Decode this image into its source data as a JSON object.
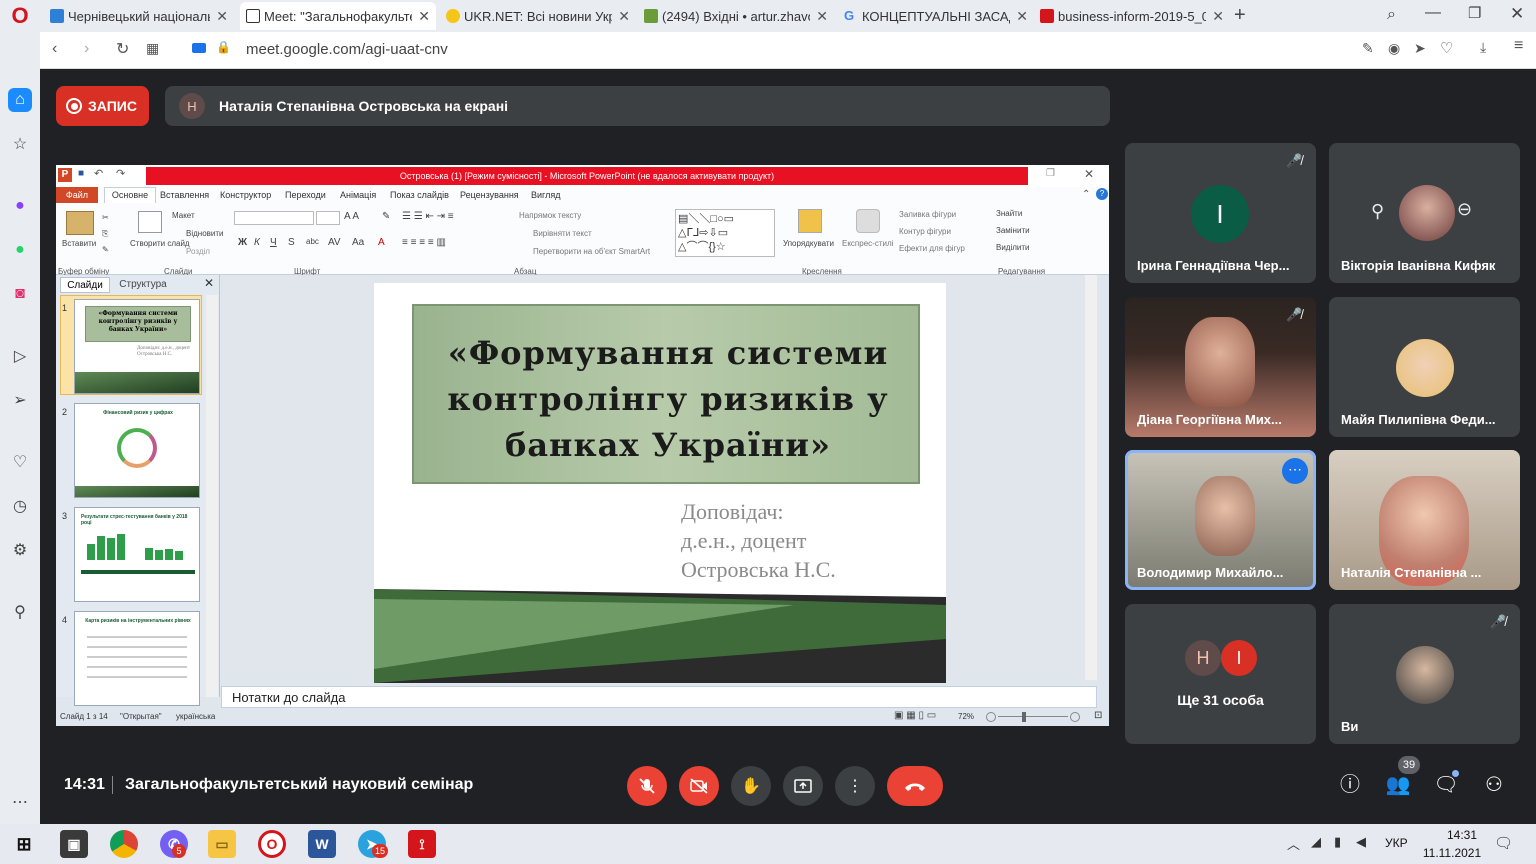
{
  "browser": {
    "tabs": [
      {
        "label": "Чернівецький національн",
        "icon_color": "#2e7fd8"
      },
      {
        "label": "Meet: \"Загальнофакультет",
        "icon_color": "#00897b"
      },
      {
        "label": "UKR.NET: Всі новини Укра",
        "icon_color": "#f5c518"
      },
      {
        "label": "(2494) Вхідні • artur.zhavor",
        "icon_color": "#6a9c3a"
      },
      {
        "label": "КОНЦЕПТУАЛЬНІ ЗАСАДИ",
        "icon_color": "#4285f4"
      },
      {
        "label": "business-inform-2019-5_0-",
        "icon_color": "#d4151c"
      }
    ],
    "url": "meet.google.com/agi-uaat-cnv",
    "logo": "O"
  },
  "meet": {
    "record_label": "ЗАПИС",
    "presenter_initial": "Н",
    "presenter_text": "Наталія Степанівна Островська на екрані",
    "time": "14:31",
    "meeting_name": "Загальнофакультетський науковий семінар",
    "participants_count": "39",
    "participants": [
      {
        "name": "Ірина Геннадіївна Чер...",
        "initial": "І",
        "avatar_color": "#0b5c44",
        "muted": true
      },
      {
        "name": "Вікторія Іванівна Кифяк",
        "muted": false
      },
      {
        "name": "Діана Георгіївна Мих...",
        "muted": true
      },
      {
        "name": "Майя Пилипівна Феди...",
        "muted": false
      },
      {
        "name": "Володимир Михайло...",
        "muted": false
      },
      {
        "name": "Наталія Степанівна ...",
        "muted": false
      },
      {
        "name": "Ще 31 особа",
        "initials": [
          "Н",
          "І"
        ]
      },
      {
        "name": "Ви",
        "muted": true
      }
    ]
  },
  "powerpoint": {
    "window_title": "Островська (1) [Режим сумісності] - Microsoft PowerPoint (не вдалося активувати продукт)",
    "tabs": [
      "Файл",
      "Основне",
      "Вставлення",
      "Конструктор",
      "Переходи",
      "Анімація",
      "Показ слайдів",
      "Рецензування",
      "Вигляд"
    ],
    "groups": [
      "Буфер обміну",
      "Слайди",
      "Шрифт",
      "Абзац",
      "Креслення",
      "Редагування"
    ],
    "ribbon_items": {
      "paste": "Вставити",
      "create_slide": "Створити слайд",
      "layout": "Макет",
      "reset": "Відновити",
      "section": "Розділ",
      "text_direction": "Напрямок тексту",
      "align_text": "Вирівняти текст",
      "smartart": "Перетворити на об'єкт SmartArt",
      "arrange": "Упорядкувати",
      "quick_styles": "Експрес-стилі",
      "shape_fill": "Заливка фігури",
      "shape_outline": "Контур фігури",
      "shape_effects": "Ефекти для фігур",
      "find": "Знайти",
      "replace": "Замінити",
      "select": "Виділити"
    },
    "pane_tabs": [
      "Слайди",
      "Структура"
    ],
    "thumbnails": [
      {
        "num": "1",
        "title": "«Формування системи контролінгу ризиків у банках України»",
        "sub": "Доповідач: д.е.н., доцент Островська Н.С."
      },
      {
        "num": "2",
        "title": "Фінансовий ризик у цифрах"
      },
      {
        "num": "3",
        "title": "Результати стрес-тестування банків у 2018 році"
      },
      {
        "num": "4",
        "title": "Карта ризиків на інструментальних рівнях"
      }
    ],
    "slide": {
      "title": "«Формування системи контролінгу ризиків у банках України»",
      "speaker_lines": [
        "Доповідач:",
        "д.е.н., доцент",
        "Островська Н.С."
      ]
    },
    "notes_placeholder": "Нотатки до слайда",
    "status": {
      "slide": "Слайд 1 з 14",
      "theme": "\"Открытая\"",
      "language": "українська",
      "zoom": "72%"
    }
  },
  "taskbar": {
    "time": "14:31",
    "date": "11.11.2021",
    "lang": "УКР",
    "badges": {
      "viber": "5",
      "telegram": "15"
    }
  },
  "colors": {
    "meet_bg": "#202124",
    "tile_bg": "#3c4043",
    "red": "#ea4335",
    "accent_blue": "#1a73e8"
  }
}
